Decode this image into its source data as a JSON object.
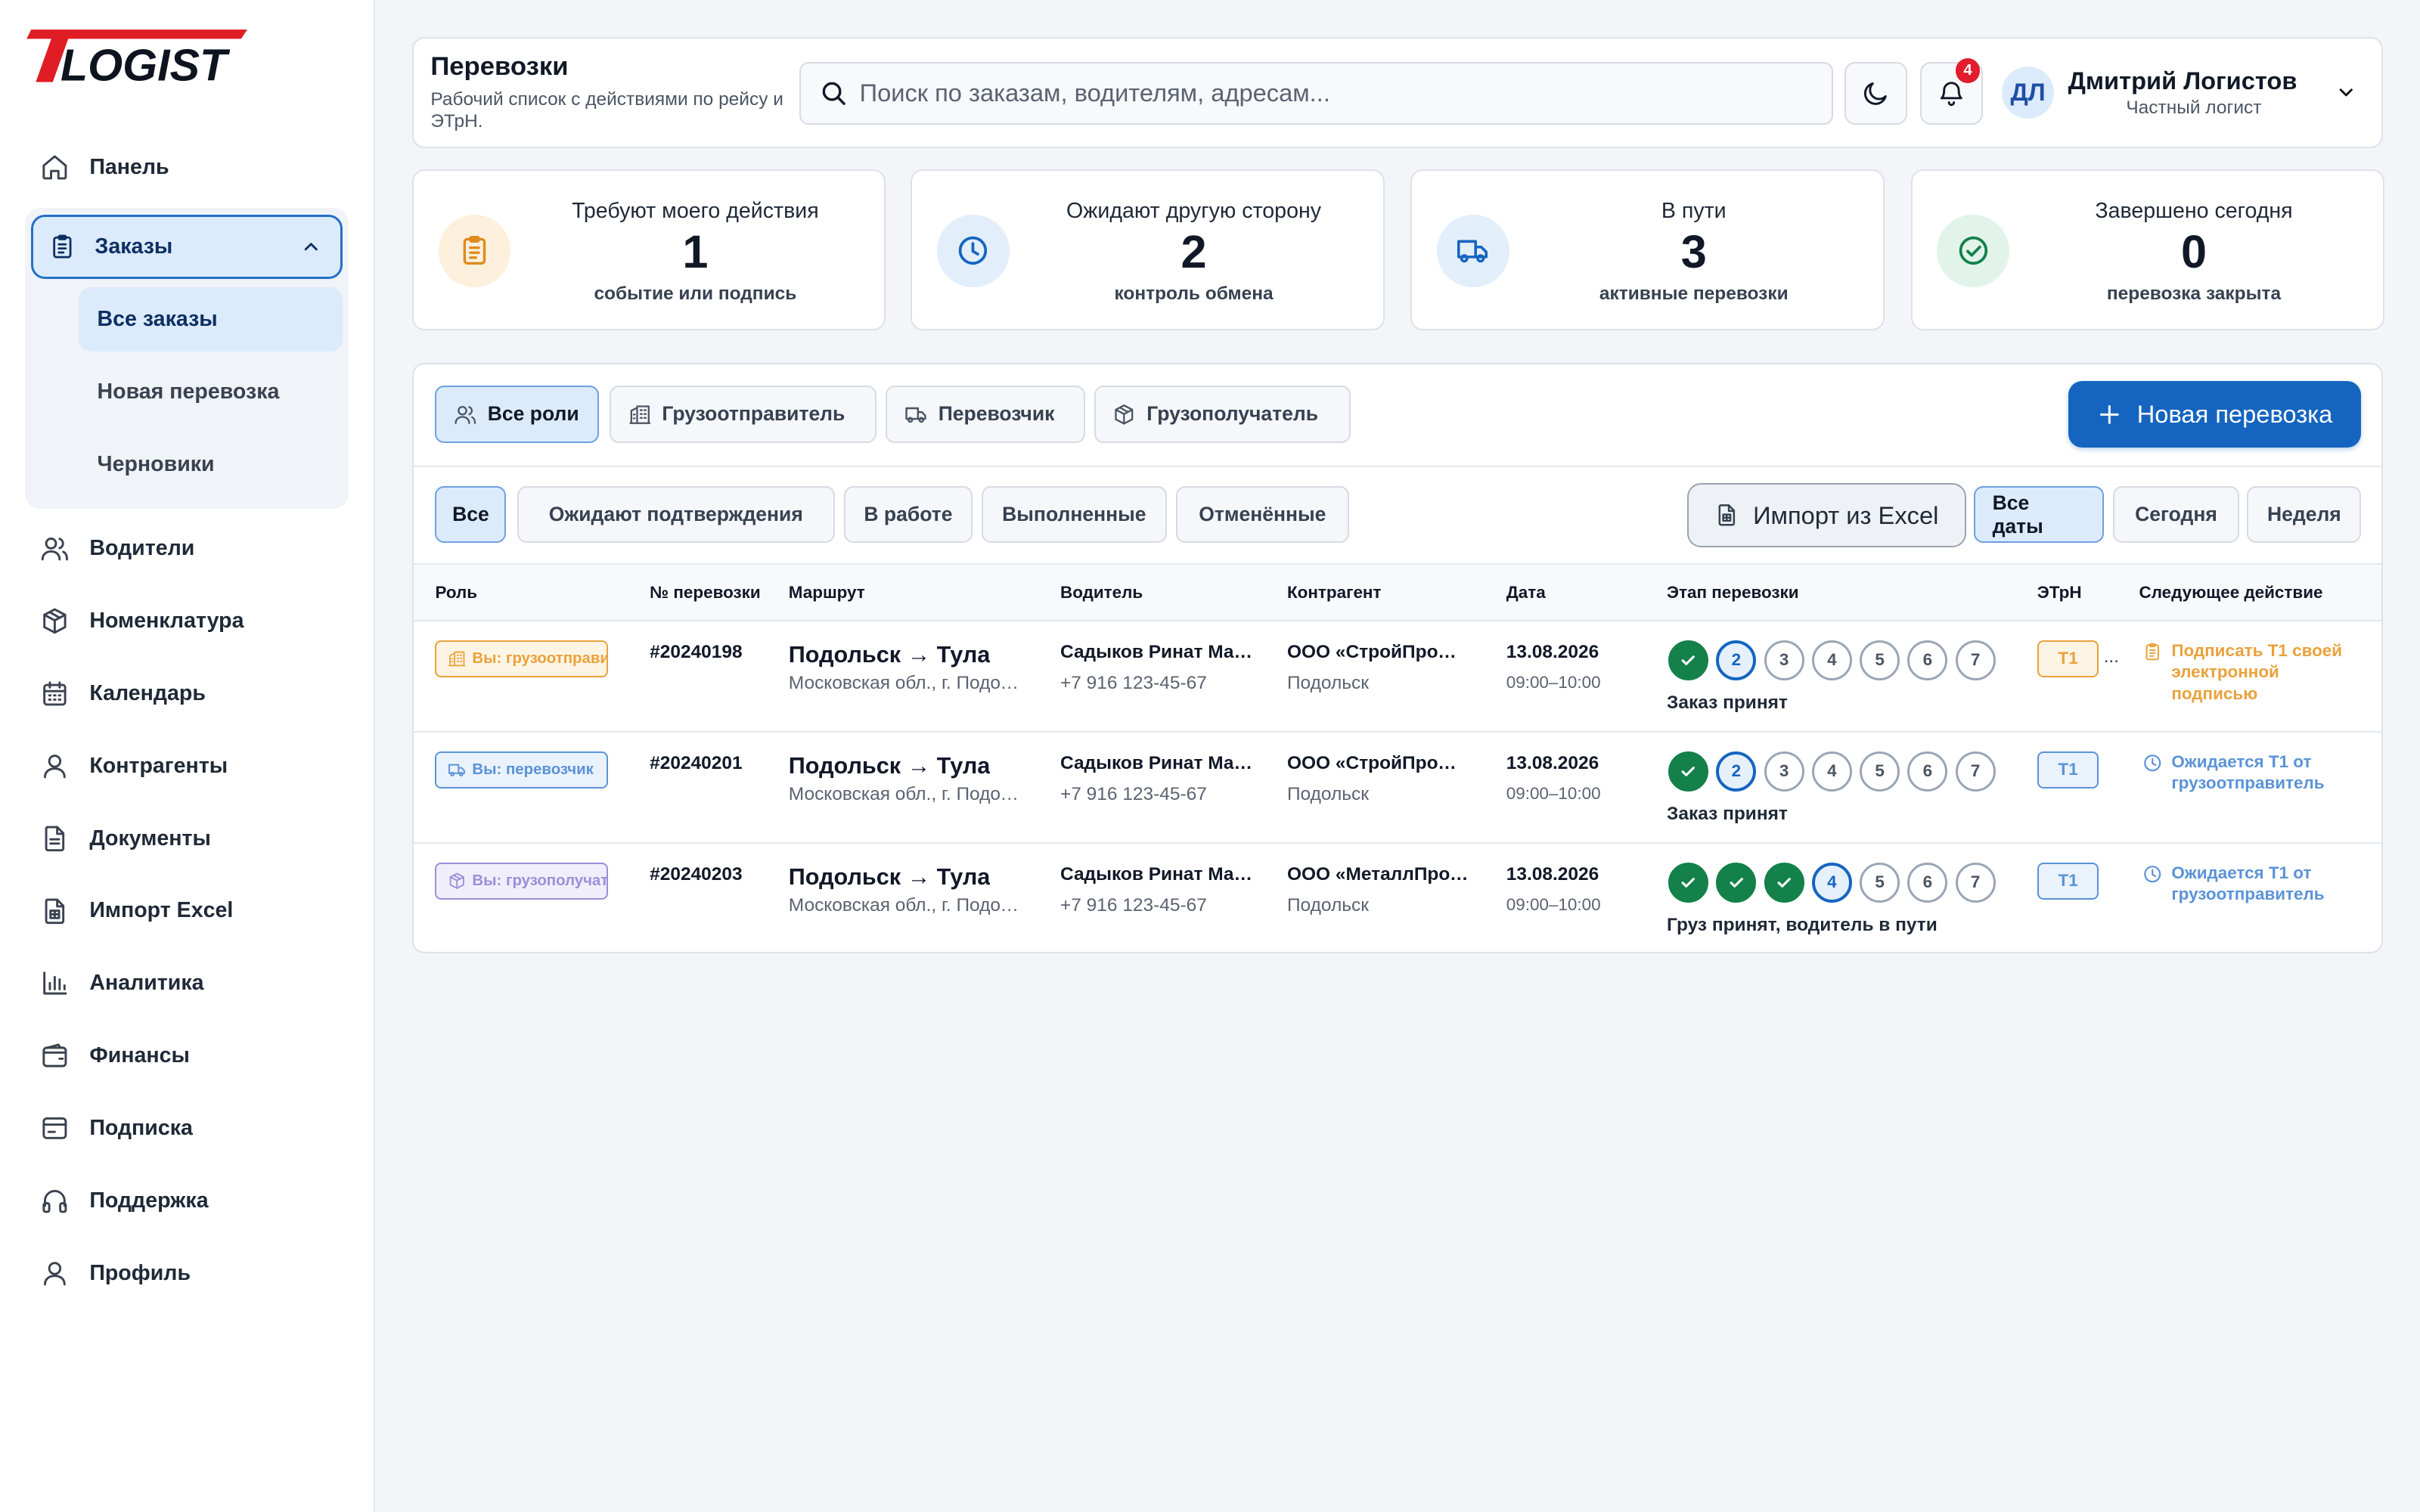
{
  "app": {
    "logo_text": "TLOGIST",
    "brand_color": "#e01c24",
    "accent_color": "#1565c0"
  },
  "sidebar": {
    "items": [
      {
        "label": "Панель",
        "icon": "home-icon"
      },
      {
        "label": "Заказы",
        "icon": "clipboard-icon",
        "expanded": true,
        "children": [
          {
            "label": "Все заказы",
            "active": true
          },
          {
            "label": "Новая перевозка"
          },
          {
            "label": "Черновики"
          }
        ]
      },
      {
        "label": "Водители",
        "icon": "users-icon"
      },
      {
        "label": "Номенклатура",
        "icon": "box-icon"
      },
      {
        "label": "Календарь",
        "icon": "calendar-icon"
      },
      {
        "label": "Контрагенты",
        "icon": "user-icon"
      },
      {
        "label": "Документы",
        "icon": "document-icon"
      },
      {
        "label": "Импорт Excel",
        "icon": "spreadsheet-icon"
      },
      {
        "label": "Аналитика",
        "icon": "bar-chart-icon"
      },
      {
        "label": "Финансы",
        "icon": "wallet-icon"
      },
      {
        "label": "Подписка",
        "icon": "card-icon"
      },
      {
        "label": "Поддержка",
        "icon": "headphones-icon"
      },
      {
        "label": "Профиль",
        "icon": "user-icon"
      }
    ]
  },
  "header": {
    "title": "Перевозки",
    "subtitle": "Рабочий список с действиями по рейсу и ЭТрН.",
    "search_placeholder": "Поиск по заказам, водителям, адресам...",
    "notifications_count": "4",
    "user": {
      "initials": "ДЛ",
      "name": "Дмитрий Логистов",
      "role": "Частный логист"
    }
  },
  "stats": [
    {
      "label": "Требуют моего действия",
      "value": "1",
      "sub": "событие или подпись",
      "icon": "clipboard-icon",
      "color": "#e08a1e",
      "bg": "#fdf0dc"
    },
    {
      "label": "Ожидают другую сторону",
      "value": "2",
      "sub": "контроль обмена",
      "icon": "clock-icon",
      "color": "#1565c0",
      "bg": "#e3eefb"
    },
    {
      "label": "В пути",
      "value": "3",
      "sub": "активные перевозки",
      "icon": "truck-icon",
      "color": "#1565c0",
      "bg": "#e3eefb"
    },
    {
      "label": "Завершено сегодня",
      "value": "0",
      "sub": "перевозка закрыта",
      "icon": "check-circle-icon",
      "color": "#14804a",
      "bg": "#e2f4ea"
    }
  ],
  "role_filters": [
    {
      "label": "Все роли",
      "icon": "users-icon",
      "active": true
    },
    {
      "label": "Грузоотправитель",
      "icon": "building-icon"
    },
    {
      "label": "Перевозчик",
      "icon": "truck-icon"
    },
    {
      "label": "Грузополучатель",
      "icon": "box-icon"
    }
  ],
  "new_shipment_button": "Новая перевозка",
  "status_filters": [
    {
      "label": "Все",
      "active": true
    },
    {
      "label": "Ожидают подтверждения"
    },
    {
      "label": "В работе"
    },
    {
      "label": "Выполненные"
    },
    {
      "label": "Отменённые"
    }
  ],
  "import_button": "Импорт из Excel",
  "date_filters": [
    {
      "label": "Все даты",
      "active": true
    },
    {
      "label": "Сегодня"
    },
    {
      "label": "Неделя"
    }
  ],
  "table": {
    "columns": [
      "Роль",
      "№ перевозки",
      "Маршрут",
      "Водитель",
      "Контрагент",
      "Дата",
      "Этап перевозки",
      "ЭТрН",
      "Следующее действие"
    ],
    "rows": [
      {
        "role": "Вы: грузоотправитель",
        "role_icon": "building-icon",
        "role_color": "#e9a23b",
        "role_bg": "#fdf4e4",
        "number": "#20240198",
        "route": "Подольск → Тула",
        "route_sub": "Московская обл., г. Подольск",
        "driver": "Садыков Ринат Маратович",
        "driver_phone": "+7 916 123-45-67",
        "counterparty": "ООО «СтройПромТорг»",
        "counterparty_city": "Подольск",
        "date": "13.08.2026",
        "time": "09:00–10:00",
        "steps_done": 1,
        "current_step": 2,
        "stage": "Заказ принят",
        "etrn": "Т1",
        "etrn_color": "#e9a23b",
        "etrn_bg": "#fdf4e4",
        "etrn_more": "...",
        "next_action": "Подписать Т1 своей электронной подписью",
        "next_icon": "clipboard-icon",
        "next_color": "#e9a23b"
      },
      {
        "role": "Вы: перевозчик",
        "role_icon": "truck-icon",
        "role_color": "#5b93d6",
        "role_bg": "#eaf2fc",
        "number": "#20240201",
        "route": "Подольск → Тула",
        "route_sub": "Московская обл., г. Подольск",
        "driver": "Садыков Ринат Маратович",
        "driver_phone": "+7 916 123-45-67",
        "counterparty": "ООО «СтройПромТорг»",
        "counterparty_city": "Подольск",
        "date": "13.08.2026",
        "time": "09:00–10:00",
        "steps_done": 1,
        "current_step": 2,
        "stage": "Заказ принят",
        "etrn": "Т1",
        "etrn_color": "#5b93d6",
        "etrn_bg": "#eaf2fc",
        "etrn_more": "",
        "next_action": "Ожидается Т1 от грузоотправитель",
        "next_icon": "clock-icon",
        "next_color": "#5b93d6"
      },
      {
        "role": "Вы: грузополучатель",
        "role_icon": "box-icon",
        "role_color": "#9a8fd8",
        "role_bg": "#f1eefb",
        "number": "#20240203",
        "route": "Подольск → Тула",
        "route_sub": "Московская обл., г. Подольск",
        "driver": "Садыков Ринат Маратович",
        "driver_phone": "+7 916 123-45-67",
        "counterparty": "ООО «МеталлПромСнаб»",
        "counterparty_city": "Подольск",
        "date": "13.08.2026",
        "time": "09:00–10:00",
        "steps_done": 3,
        "current_step": 4,
        "stage": "Груз принят, водитель в пути",
        "etrn": "Т1",
        "etrn_color": "#5b93d6",
        "etrn_bg": "#eaf2fc",
        "etrn_more": "",
        "next_action": "Ожидается Т1 от грузоотправитель",
        "next_icon": "clock-icon",
        "next_color": "#5b93d6"
      }
    ],
    "step_labels": [
      "1",
      "2",
      "3",
      "4",
      "5",
      "6",
      "7"
    ]
  }
}
